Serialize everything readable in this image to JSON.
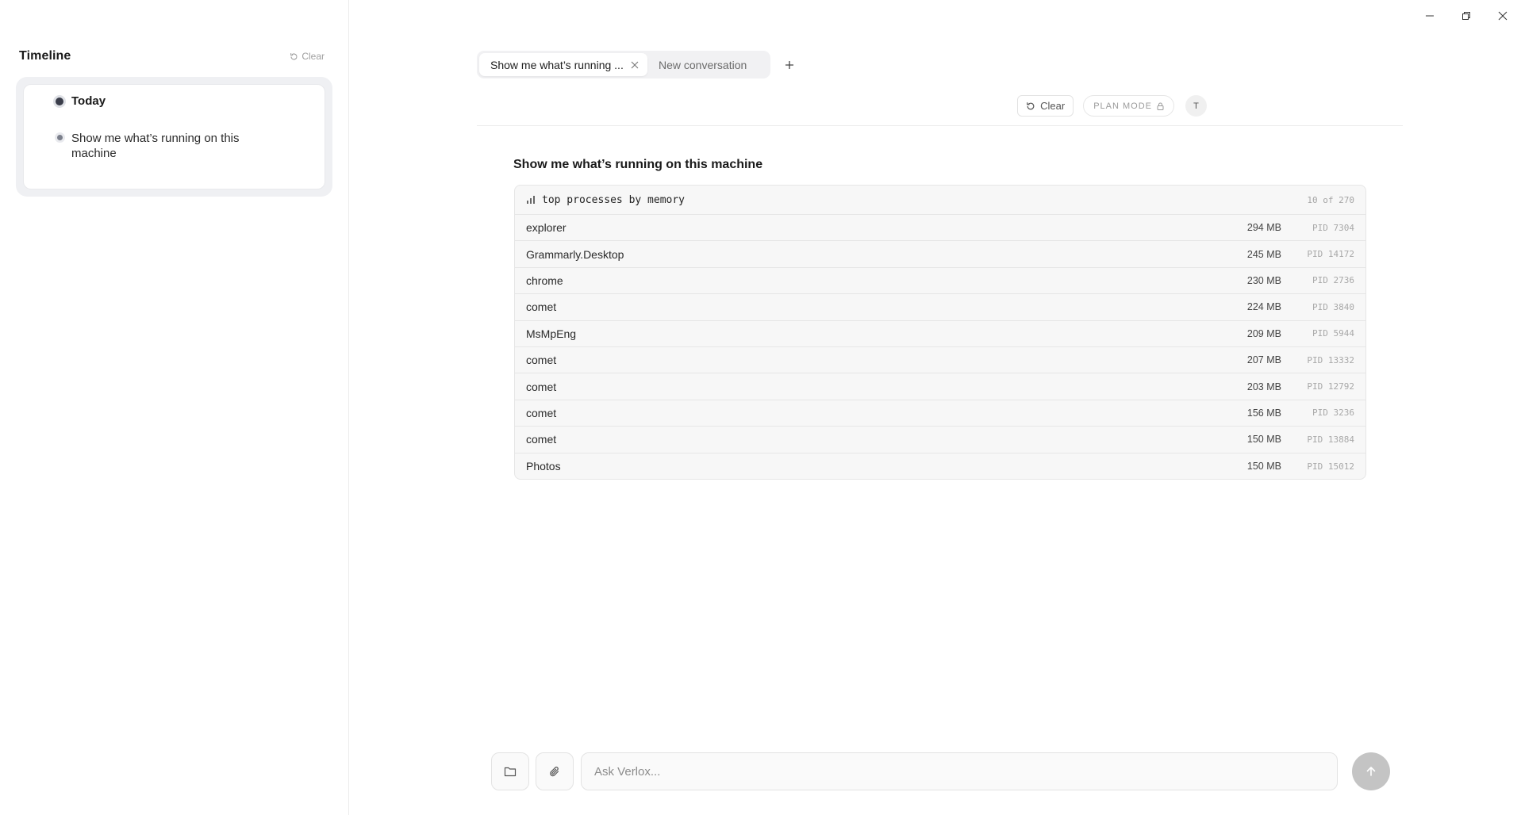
{
  "window": {
    "minimize_icon": "minimize-icon",
    "restore_icon": "restore-icon",
    "close_icon": "close-icon"
  },
  "sidebar": {
    "title": "Timeline",
    "clear_label": "Clear",
    "groups": [
      {
        "label": "Today",
        "items": [
          {
            "label": "Show me what’s running on this machine"
          }
        ]
      }
    ]
  },
  "tabs": [
    {
      "label": "Show me what’s running ...",
      "active": true
    },
    {
      "label": "New conversation",
      "active": false
    }
  ],
  "toolbar": {
    "clear_label": "Clear",
    "plan_mode_label": "PLAN MODE",
    "avatar_initial": "T"
  },
  "message": {
    "title": "Show me what’s running on this machine",
    "panel": {
      "header": "top processes by memory",
      "count": "10 of 270",
      "rows": [
        {
          "name": "explorer",
          "memory": "294 MB",
          "pid": "PID 7304"
        },
        {
          "name": "Grammarly.Desktop",
          "memory": "245 MB",
          "pid": "PID 14172"
        },
        {
          "name": "chrome",
          "memory": "230 MB",
          "pid": "PID 2736"
        },
        {
          "name": "comet",
          "memory": "224 MB",
          "pid": "PID 3840"
        },
        {
          "name": "MsMpEng",
          "memory": "209 MB",
          "pid": "PID 5944"
        },
        {
          "name": "comet",
          "memory": "207 MB",
          "pid": "PID 13332"
        },
        {
          "name": "comet",
          "memory": "203 MB",
          "pid": "PID 12792"
        },
        {
          "name": "comet",
          "memory": "156 MB",
          "pid": "PID 3236"
        },
        {
          "name": "comet",
          "memory": "150 MB",
          "pid": "PID 13884"
        },
        {
          "name": "Photos",
          "memory": "150 MB",
          "pid": "PID 15012"
        }
      ]
    }
  },
  "composer": {
    "placeholder": "Ask Verlox...",
    "value": ""
  },
  "colors": {
    "accent_dark": "#3a3d4a",
    "send_button": "#c4c4c4",
    "border": "#e6e6e6"
  }
}
